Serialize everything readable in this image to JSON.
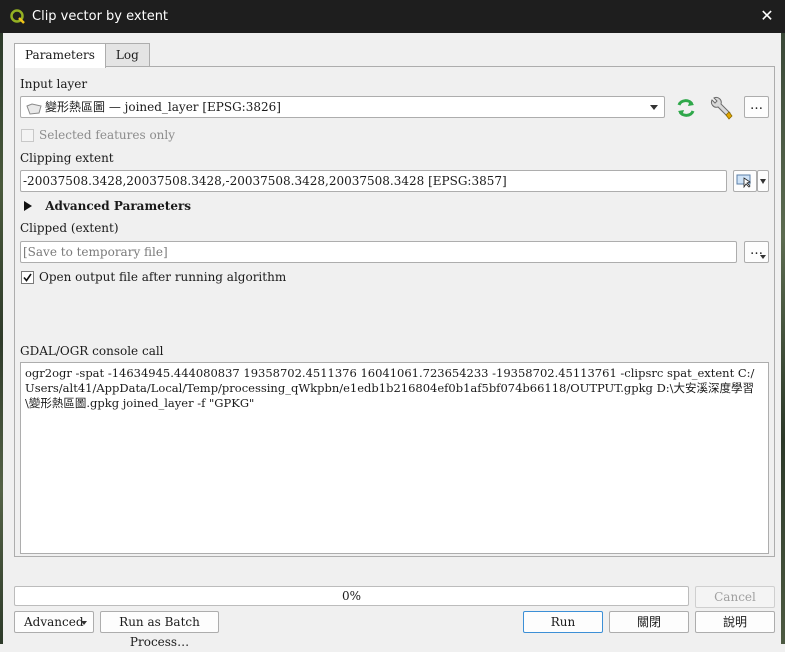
{
  "window": {
    "title": "Clip vector by extent",
    "close_icon": "close-icon"
  },
  "tabs": [
    {
      "label": "Parameters",
      "active": true
    },
    {
      "label": "Log",
      "active": false
    }
  ],
  "input_layer": {
    "label": "Input layer",
    "value": "變形熱區圖 — joined_layer [EPSG:3826]",
    "more_label": "…"
  },
  "selected_only": {
    "label": "Selected features only",
    "checked": false,
    "enabled": false
  },
  "clipping_extent": {
    "label": "Clipping extent",
    "value": "-20037508.3428,20037508.3428,-20037508.3428,20037508.3428 [EPSG:3857]"
  },
  "advanced_params": {
    "label": "Advanced Parameters"
  },
  "output": {
    "label": "Clipped (extent)",
    "placeholder": "[Save to temporary file]",
    "more_label": "…"
  },
  "open_after": {
    "label": "Open output file after running algorithm",
    "checked": true
  },
  "console": {
    "label": "GDAL/OGR console call",
    "text": "ogr2ogr -spat -14634945.444080837 19358702.4511376 16041061.723654233 -19358702.45113761 -clipsrc spat_extent C:/Users/alt41/AppData/Local/Temp/processing_qWkpbn/e1edb1b216804ef0b1af5bf074b66118/OUTPUT.gpkg D:\\大安溪深度學習\\變形熱區圖.gpkg joined_layer -f \"GPKG\""
  },
  "progress": {
    "text": "0%",
    "value": 0
  },
  "buttons": {
    "cancel": "Cancel",
    "advanced": "Advanced",
    "batch": "Run as Batch Process…",
    "run": "Run",
    "close": "關閉",
    "help": "說明"
  },
  "colors": {
    "titlebar": "#1e1e1e",
    "accent": "#3c8fd6",
    "sync_icon": "#2fa84a"
  }
}
